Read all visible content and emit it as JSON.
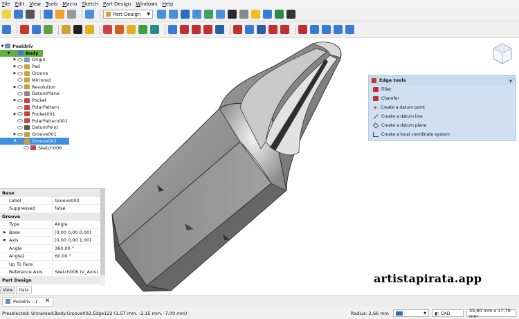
{
  "menu": [
    "File",
    "Edit",
    "View",
    "Tools",
    "Macro",
    "Sketch",
    "Part Design",
    "Windows",
    "Help"
  ],
  "workbench": {
    "selected": "Part Design"
  },
  "toolbar_colors": {
    "row1": [
      "#f2d24a",
      "#3a7bd5",
      "#555",
      "#3a7bd5",
      "#f0a030",
      "#999",
      "#4a90d9",
      "#4a90d9",
      "#4a90d9",
      "#2a6fbf",
      "#4a90d9",
      "#40a060",
      "#4a90d9",
      "#2a2a2a",
      "#888",
      "#f0c020",
      "#3a7bd5",
      "#2a8a4a",
      "#333"
    ],
    "row2": [
      "#3a7bd5",
      "#c0392b",
      "#3a7bd5",
      "#60a040",
      "#d0a030",
      "#222",
      "#e0b020",
      "#d04040",
      "#d06020",
      "#e0b020",
      "#40a040",
      "#2a8a8a",
      "#3a7bd5",
      "#c03030",
      "#c03030",
      "#c03030",
      "#2a5fa0",
      "#c03030",
      "#3a7bd5",
      "#2a5fa0",
      "#c03030",
      "#c03030",
      "#c03030",
      "#3a7bd5",
      "#3a7bd5",
      "#3a7bd5",
      "#3a7bd5"
    ]
  },
  "tree": {
    "root": "Pozidriv",
    "items": [
      {
        "label": "Body",
        "indent": 1,
        "expander": "▼",
        "state": "body",
        "icon_color": "#3a7bd5"
      },
      {
        "label": "Origin",
        "indent": 2,
        "expander": "▶",
        "state": "normal",
        "icon_color": "#7a9cc8"
      },
      {
        "label": "Pad",
        "indent": 2,
        "expander": "▶",
        "state": "normal",
        "icon_color": "#c8a040"
      },
      {
        "label": "Groove",
        "indent": 2,
        "expander": "▶",
        "state": "normal",
        "icon_color": "#c8a040"
      },
      {
        "label": "Mirrored",
        "indent": 2,
        "expander": "",
        "state": "normal",
        "icon_color": "#c8a040"
      },
      {
        "label": "Revolution",
        "indent": 2,
        "expander": "▶",
        "state": "normal",
        "icon_color": "#c8a040"
      },
      {
        "label": "DatumPlane",
        "indent": 2,
        "expander": "",
        "state": "normal",
        "icon_color": "#888"
      },
      {
        "label": "Pocket",
        "indent": 2,
        "expander": "▶",
        "state": "normal",
        "icon_color": "#c84040"
      },
      {
        "label": "PolarPattern",
        "indent": 2,
        "expander": "",
        "state": "normal",
        "icon_color": "#c84040"
      },
      {
        "label": "Pocket001",
        "indent": 2,
        "expander": "▶",
        "state": "normal",
        "icon_color": "#c84040"
      },
      {
        "label": "PolarPattern001",
        "indent": 2,
        "expander": "",
        "state": "normal",
        "icon_color": "#c84040"
      },
      {
        "label": "DatumPoint",
        "indent": 2,
        "expander": "",
        "state": "normal",
        "icon_color": "#555"
      },
      {
        "label": "Groove001",
        "indent": 2,
        "expander": "▶",
        "state": "normal",
        "icon_color": "#c8a040"
      },
      {
        "label": "Groove002",
        "indent": 2,
        "expander": "▼",
        "state": "selected",
        "icon_color": "#c8a040"
      },
      {
        "label": "Sketch006",
        "indent": 3,
        "expander": "",
        "state": "normal",
        "icon_color": "#c84040"
      }
    ]
  },
  "properties": {
    "groups": [
      {
        "name": "Base",
        "rows": [
          {
            "key": "Label",
            "value": "Groove002",
            "expander": ""
          },
          {
            "key": "Suppressed",
            "value": "false",
            "expander": ""
          }
        ]
      },
      {
        "name": "Groove",
        "rows": [
          {
            "key": "Type",
            "value": "Angle",
            "expander": ""
          },
          {
            "key": "Base",
            "value": "[0,00 0,00 0,00]",
            "expander": "▶"
          },
          {
            "key": "Axis",
            "value": "[0,00 0,00 1,00]",
            "expander": "▶"
          },
          {
            "key": "Angle",
            "value": "360,00 °",
            "expander": ""
          },
          {
            "key": "Angle2",
            "value": "60,00 °",
            "expander": ""
          },
          {
            "key": "Up To Face",
            "value": "",
            "expander": ""
          },
          {
            "key": "Reference Axis",
            "value": "Sketch006 (V_Axis)",
            "expander": ""
          }
        ]
      },
      {
        "name": "Part Design",
        "rows": []
      }
    ]
  },
  "left_tabs": [
    "View",
    "Data"
  ],
  "edge_tools": {
    "title": "Edge tools",
    "items": [
      {
        "label": "Fillet",
        "icon": "fillet-icon",
        "color": "#c03030"
      },
      {
        "label": "Chamfer",
        "icon": "chamfer-icon",
        "color": "#c03030"
      },
      {
        "label": "Create a datum point",
        "icon": "datum-point-icon",
        "color": "#c03030"
      },
      {
        "label": "Create a datum line",
        "icon": "datum-line-icon",
        "color": "#333"
      },
      {
        "label": "Create a datum plane",
        "icon": "datum-plane-icon",
        "color": "#333"
      },
      {
        "label": "Create a local coordinate system",
        "icon": "local-cs-icon",
        "color": "#333"
      }
    ]
  },
  "watermark": "artistapirata.app",
  "document_tab": {
    "label": "Pozidriv : 1"
  },
  "status": {
    "message": "Preselected: Unnamed.Body.Groove002.Edge122 (1.57 mm, -2.15 mm, -7.00 mm)",
    "radius": "Radius: 2,66 mm",
    "nav_style": "CAD",
    "dimensions": "35,60 mm x 17,79 mm"
  }
}
